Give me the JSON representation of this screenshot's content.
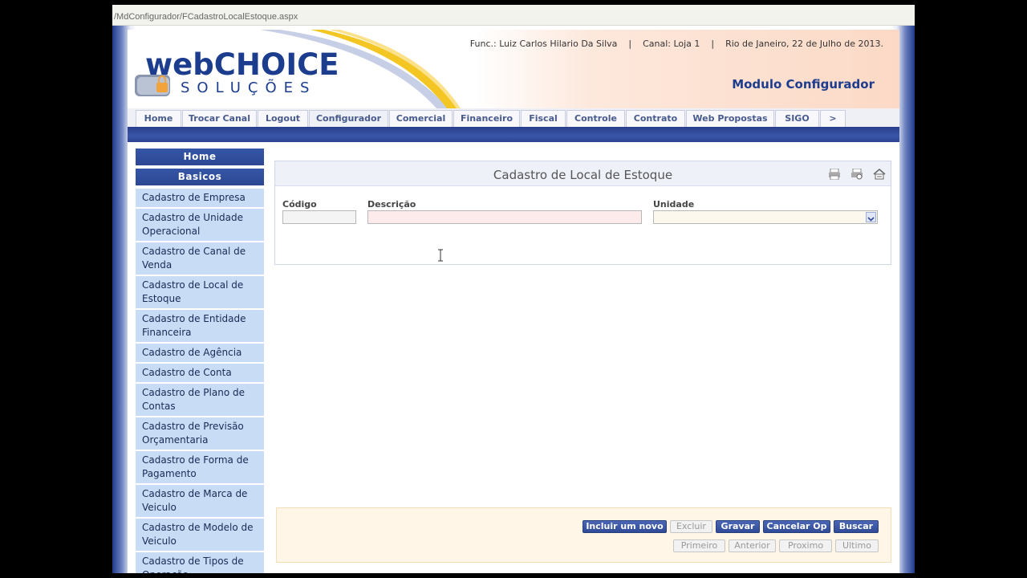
{
  "browser": {
    "address": "/MdConfigurador/FCadastroLocalEstoque.aspx"
  },
  "header": {
    "logo_top": "webCHOICE",
    "logo_bottom": "SOLUÇÕES",
    "info": "Func.: Luiz Carlos Hilario Da Silva    |    Canal: Loja 1    |    Rio de Janeiro, 22 de Julho de 2013.",
    "module": "Modulo Configurador"
  },
  "tabs": [
    "Home",
    "Trocar Canal",
    "Logout",
    "Configurador",
    "Comercial",
    "Financeiro",
    "Fiscal",
    "Controle",
    "Contrato",
    "Web Propostas",
    "SIGO",
    ">"
  ],
  "sidebar": {
    "home": "Home",
    "section": "Basicos",
    "items": [
      "Cadastro de Empresa",
      "Cadastro de Unidade Operacional",
      "Cadastro de Canal de Venda",
      "Cadastro de Local de Estoque",
      "Cadastro de Entidade Financeira",
      "Cadastro de Agência",
      "Cadastro de Conta",
      "Cadastro de Plano de Contas",
      "Cadastro de Previsão Orçamentaria",
      "Cadastro de Forma de Pagamento",
      "Cadastro de Marca de Veiculo",
      "Cadastro de Modelo de Veiculo",
      "Cadastro de Tipos de Operação"
    ]
  },
  "form": {
    "title": "Cadastro de Local de Estoque",
    "codigo_label": "Código",
    "descricao_label": "Descrição",
    "unidade_label": "Unidade",
    "codigo_value": "",
    "descricao_value": "",
    "unidade_value": ""
  },
  "buttons": {
    "incluir": "Incluir um novo",
    "excluir": "Excluir",
    "gravar": "Gravar",
    "cancelar": "Cancelar Op",
    "buscar": "Buscar",
    "primeiro": "Primeiro",
    "anterior": "Anterior",
    "proximo": "Proximo",
    "ultimo": "Ultimo"
  },
  "colors": {
    "brand_blue": "#1c3c8e",
    "sidebar_item": "#c8dcf6",
    "required_field": "#fdeaea",
    "select_field": "#fdf8ee"
  },
  "icons": [
    "print-icon",
    "print-preview-icon",
    "home-back-icon",
    "text-cursor-icon"
  ]
}
